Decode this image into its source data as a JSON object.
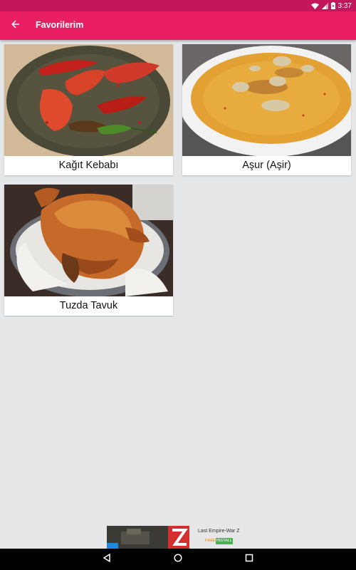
{
  "status_bar": {
    "time": "3:37",
    "icons": [
      "wifi-icon",
      "signal-icon",
      "battery-icon"
    ]
  },
  "app_bar": {
    "title": "Favorilerim",
    "back_icon": "arrow-back-icon",
    "color": "#e91e63",
    "status_color": "#c2185b"
  },
  "favorites": [
    {
      "name": "Kağıt Kebabı"
    },
    {
      "name": "Aşur (Aşir)"
    },
    {
      "name": "Tuzda Tavuk"
    }
  ],
  "ad": {
    "title": "Last Empire-War Z",
    "price": "FREE",
    "button": "INSTALL"
  },
  "nav_bar": {
    "buttons": [
      "back-triangle-icon",
      "home-circle-icon",
      "recents-square-icon"
    ]
  }
}
